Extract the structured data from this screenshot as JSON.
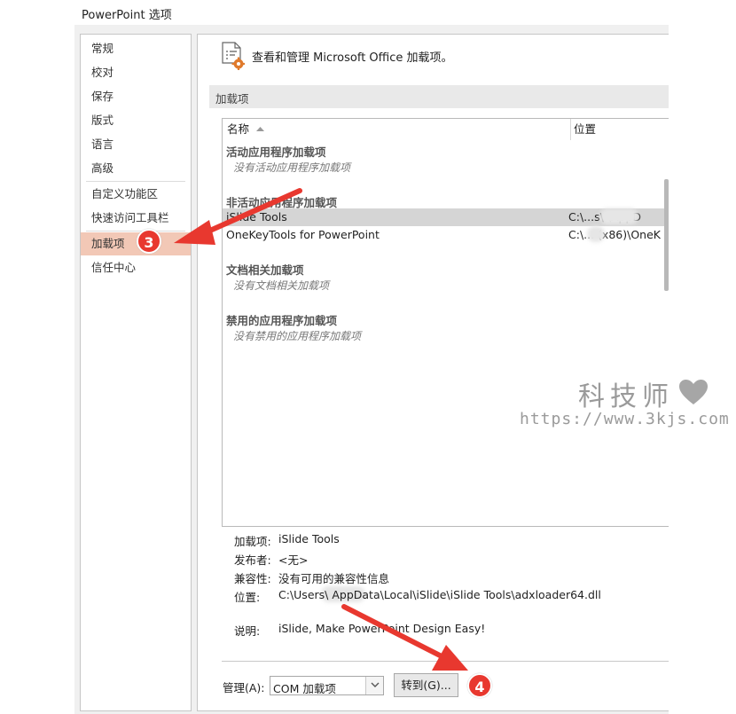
{
  "window": {
    "title": "PowerPoint 选项"
  },
  "sidebar": {
    "items": [
      {
        "label": "常规"
      },
      {
        "label": "校对"
      },
      {
        "label": "保存"
      },
      {
        "label": "版式"
      },
      {
        "label": "语言"
      },
      {
        "label": "高级"
      },
      {
        "label": "自定义功能区"
      },
      {
        "label": "快速访问工具栏"
      },
      {
        "label": "加载项"
      },
      {
        "label": "信任中心"
      }
    ],
    "active_index": 8
  },
  "main": {
    "header_text": "查看和管理 Microsoft Office 加载项。",
    "section_title": "加载项",
    "table": {
      "col_name": "名称",
      "col_location": "位置",
      "groups": [
        {
          "title": "活动应用程序加载项",
          "empty_text": "没有活动应用程序加载项"
        },
        {
          "title": "非活动应用程序加载项",
          "rows": [
            {
              "name": "iSlide Tools",
              "location": "C:\\...s\\          \\AppD"
            },
            {
              "name": "OneKeyTools for PowerPoint",
              "location": "C:\\...       (x86)\\OneK"
            }
          ]
        },
        {
          "title": "文档相关加载项",
          "empty_text": "没有文档相关加载项"
        },
        {
          "title": "禁用的应用程序加载项",
          "empty_text": "没有禁用的应用程序加载项"
        }
      ]
    },
    "details": {
      "addin_label": "加载项:",
      "addin_value": "iSlide Tools",
      "publisher_label": "发布者:",
      "publisher_value": "<无>",
      "compat_label": "兼容性:",
      "compat_value": "没有可用的兼容性信息",
      "location_label": "位置:",
      "location_value": "C:\\Users\\          AppData\\Local\\iSlide\\iSlide Tools\\adxloader64.dll",
      "desc_label": "说明:",
      "desc_value": "iSlide, Make PowerPoint Design Easy!"
    },
    "manage": {
      "label": "管理(A):",
      "selected": "COM 加载项",
      "go_button": "转到(G)..."
    }
  },
  "annotations": {
    "step3": "3",
    "step4": "4",
    "arrow_color": "#e8382f"
  },
  "watermark": {
    "title": "科技师",
    "url": "https://www.3kjs.com"
  }
}
